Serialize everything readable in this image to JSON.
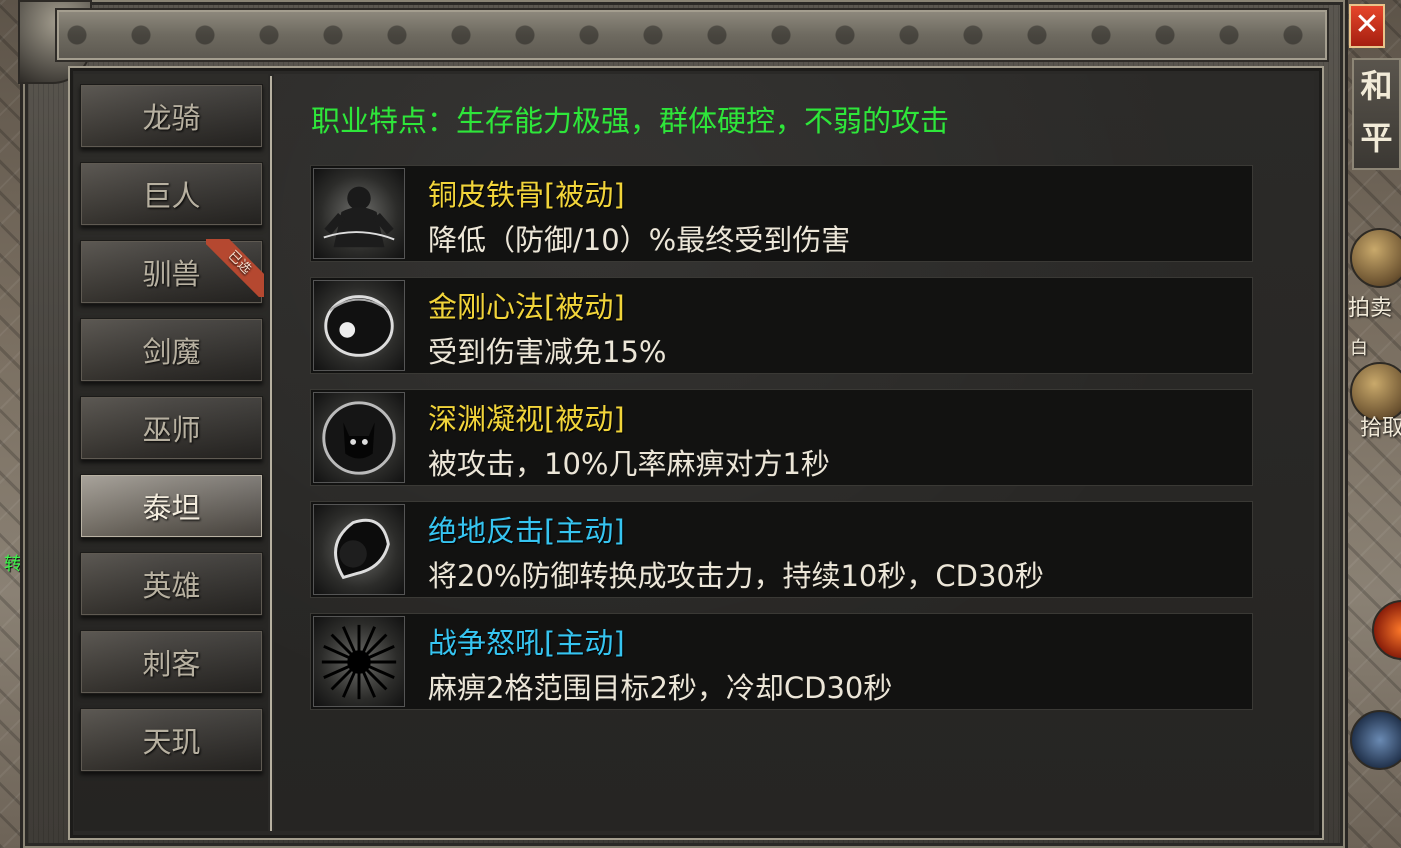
{
  "classes": [
    {
      "label": "龙骑",
      "active": false
    },
    {
      "label": "巨人",
      "active": false
    },
    {
      "label": "驯兽",
      "active": false,
      "badge": "已选"
    },
    {
      "label": "剑魔",
      "active": false
    },
    {
      "label": "巫师",
      "active": false
    },
    {
      "label": "泰坦",
      "active": true
    },
    {
      "label": "英雄",
      "active": false
    },
    {
      "label": "刺客",
      "active": false
    },
    {
      "label": "天玑",
      "active": false
    }
  ],
  "feature": "职业特点：生存能力极强，群体硬控，不弱的攻击",
  "skills": [
    {
      "name": "铜皮铁骨[被动]",
      "desc": "降低（防御/10）%最终受到伤害",
      "type": "passive",
      "icon": "golem-icon"
    },
    {
      "name": "金刚心法[被动]",
      "desc": "受到伤害减免15%",
      "type": "passive",
      "icon": "orb-shield-icon"
    },
    {
      "name": "深渊凝视[被动]",
      "desc": "被攻击，10%几率麻痹对方1秒",
      "type": "passive",
      "icon": "demon-eye-icon"
    },
    {
      "name": "绝地反击[主动]",
      "desc": "将20%防御转换成攻击力，持续10秒，CD30秒",
      "type": "active",
      "icon": "counter-strike-icon"
    },
    {
      "name": "战争怒吼[主动]",
      "desc": "麻痹2格范围目标2秒，冷却CD30秒",
      "type": "active",
      "icon": "war-roar-icon"
    }
  ],
  "colors": {
    "feature": "#2ee63a",
    "passive": "#f1d43a",
    "active": "#36c4f0",
    "desc": "#ece6d8"
  },
  "hud": {
    "close": "✕",
    "peace": "和平",
    "auction": "拍卖",
    "pickup": "拾取",
    "white": "白",
    "rebirth": "转生"
  }
}
